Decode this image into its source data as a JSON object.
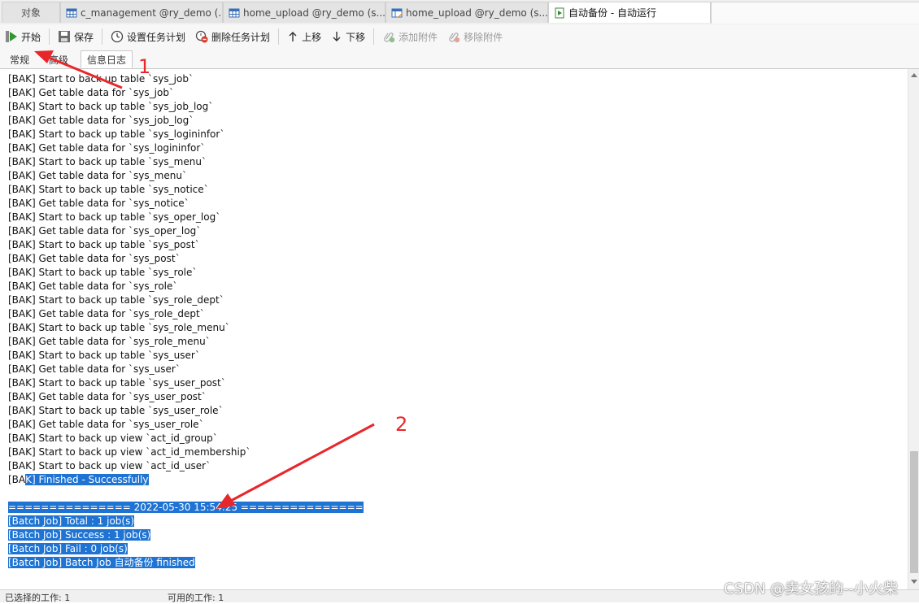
{
  "tabs": [
    {
      "label": "对象",
      "icon": "none"
    },
    {
      "label": "c_management @ry_demo (...",
      "icon": "table-icon"
    },
    {
      "label": "home_upload @ry_demo (s...",
      "icon": "table-icon"
    },
    {
      "label": "home_upload @ry_demo (s...",
      "icon": "table-edit-icon"
    },
    {
      "label": "自动备份 - 自动运行",
      "icon": "batch-job-icon"
    }
  ],
  "toolbar": {
    "start": "开始",
    "save": "保存",
    "set_schedule": "设置任务计划",
    "delete_schedule": "删除任务计划",
    "move_up": "上移",
    "move_down": "下移",
    "add_attachment": "添加附件",
    "remove_attachment": "移除附件"
  },
  "subtabs": [
    "常规",
    "高级",
    "信息日志"
  ],
  "log": {
    "lines": [
      "[BAK] Start to back up table `sys_job`",
      "[BAK] Get table data for `sys_job`",
      "[BAK] Start to back up table `sys_job_log`",
      "[BAK] Get table data for `sys_job_log`",
      "[BAK] Start to back up table `sys_logininfor`",
      "[BAK] Get table data for `sys_logininfor`",
      "[BAK] Start to back up table `sys_menu`",
      "[BAK] Get table data for `sys_menu`",
      "[BAK] Start to back up table `sys_notice`",
      "[BAK] Get table data for `sys_notice`",
      "[BAK] Start to back up table `sys_oper_log`",
      "[BAK] Get table data for `sys_oper_log`",
      "[BAK] Start to back up table `sys_post`",
      "[BAK] Get table data for `sys_post`",
      "[BAK] Start to back up table `sys_role`",
      "[BAK] Get table data for `sys_role`",
      "[BAK] Start to back up table `sys_role_dept`",
      "[BAK] Get table data for `sys_role_dept`",
      "[BAK] Start to back up table `sys_role_menu`",
      "[BAK] Get table data for `sys_role_menu`",
      "[BAK] Start to back up table `sys_user`",
      "[BAK] Get table data for `sys_user`",
      "[BAK] Start to back up table `sys_user_post`",
      "[BAK] Get table data for `sys_user_post`",
      "[BAK] Start to back up table `sys_user_role`",
      "[BAK] Get table data for `sys_user_role`",
      "[BAK] Start to back up view `act_id_group`",
      "[BAK] Start to back up view `act_id_membership`",
      "[BAK] Start to back up view `act_id_user`"
    ],
    "finished_prefix": "[BA",
    "finished_rest": "K] Finished - Successfully",
    "separator": "=============== 2022-05-30 15:54:25 ===============",
    "batch_total": "[Batch Job] Total : 1 job(s)",
    "batch_success": "[Batch Job] Success : 1 job(s)",
    "batch_fail": "[Batch Job] Fail : 0 job(s)",
    "batch_finished": "[Batch Job] Batch Job 自动备份 finished"
  },
  "status": {
    "selected": "已选择的工作: 1",
    "available": "可用的工作: 1"
  },
  "annotations": {
    "label1": "1",
    "label2": "2",
    "color": "#e8272b"
  },
  "watermark": "CSDN @卖女孩的--小火柴"
}
